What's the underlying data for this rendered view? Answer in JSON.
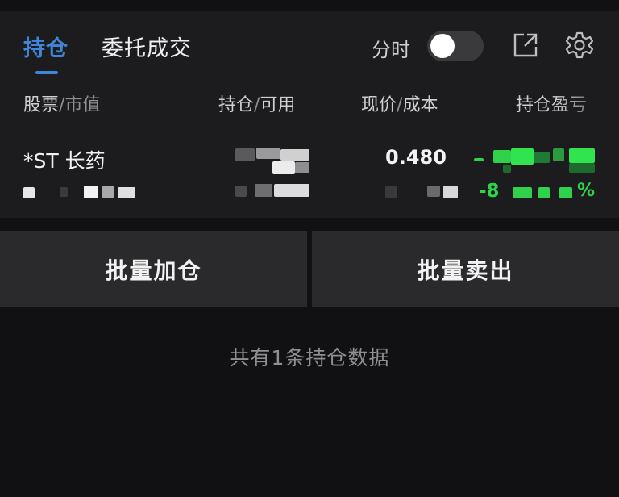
{
  "tabs": [
    {
      "label": "持仓",
      "active": true
    },
    {
      "label": "委托成交",
      "active": false
    }
  ],
  "header": {
    "timeshare_label": "分时",
    "timeshare_enabled": false
  },
  "columns": {
    "stock": {
      "main": "股票",
      "sep": "/",
      "sub": "市值"
    },
    "position": {
      "main": "持仓",
      "sep": "/",
      "sub": "可用"
    },
    "price": {
      "main": "现价",
      "sep": "/",
      "sub": "成本"
    },
    "pnl": {
      "main": "持仓盈亏"
    }
  },
  "holding": {
    "name": "*ST 长药",
    "price": "0.480",
    "pnl_pct_prefix": "-8",
    "pnl_pct_suffix": "%"
  },
  "actions": {
    "batch_add": "批量加仓",
    "batch_sell": "批量卖出"
  },
  "summary": "共有1条持仓数据",
  "icons": [
    "external-link-icon",
    "gear-icon"
  ],
  "colors": {
    "accent": "#3d86d9",
    "loss": "#2fd24a",
    "background": "#111113",
    "panel": "#1c1c1e",
    "button": "#2a2a2c"
  }
}
